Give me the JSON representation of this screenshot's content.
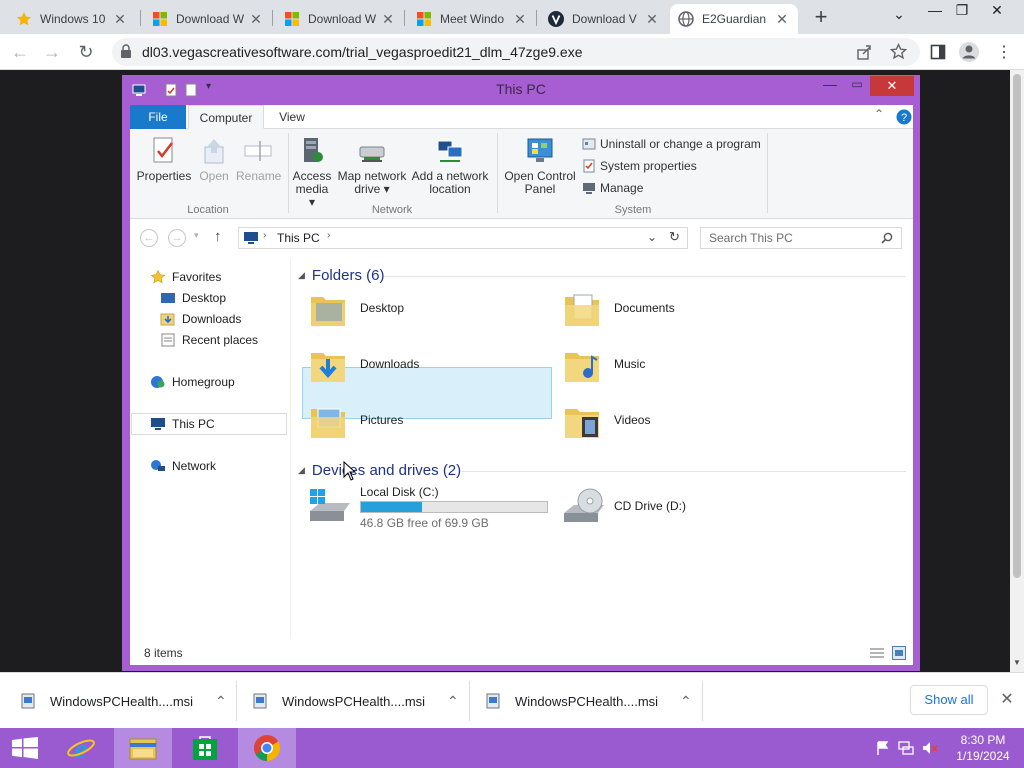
{
  "browser": {
    "tabs": [
      {
        "title": "Windows 10",
        "icon": "star-icon",
        "color": "#f4b400"
      },
      {
        "title": "Download W",
        "icon": "windows-logo-icon"
      },
      {
        "title": "Download W",
        "icon": "windows-logo-icon"
      },
      {
        "title": "Meet Windo",
        "icon": "windows-logo-icon"
      },
      {
        "title": "Download V",
        "icon": "v-logo-icon"
      },
      {
        "title": "E2Guardian",
        "icon": "globe-icon",
        "active": true
      }
    ],
    "new_tab": "+",
    "url": "dl03.vegascreativesoftware.com/trial_vegasproedit21_dlm_47zge9.exe"
  },
  "explorer": {
    "title": "This PC",
    "ribbon_tabs": [
      "File",
      "Computer",
      "View"
    ],
    "location_group": {
      "label": "Location",
      "buttons": [
        {
          "label": "Properties",
          "enabled": true
        },
        {
          "label": "Open",
          "enabled": false
        },
        {
          "label": "Rename",
          "enabled": false
        }
      ]
    },
    "network_group": {
      "label": "Network",
      "buttons": [
        {
          "label": "Access media",
          "line1": "Access",
          "line2": "media ▾"
        },
        {
          "label": "Map network drive",
          "line1": "Map network",
          "line2": "drive ▾"
        },
        {
          "label": "Add a network location",
          "line1": "Add a network",
          "line2": "location"
        }
      ]
    },
    "system_group": {
      "label": "System",
      "big": {
        "line1": "Open Control",
        "line2": "Panel"
      },
      "items": [
        "Uninstall or change a program",
        "System properties",
        "Manage"
      ]
    },
    "address_path": "This PC",
    "search_placeholder": "Search This PC",
    "nav": {
      "favorites": "Favorites",
      "favorite_items": [
        "Desktop",
        "Downloads",
        "Recent places"
      ],
      "homegroup": "Homegroup",
      "this_pc": "This PC",
      "network": "Network"
    },
    "folders_header": "Folders (6)",
    "folders": [
      "Desktop",
      "Documents",
      "Downloads",
      "Music",
      "Pictures",
      "Videos"
    ],
    "selected_folder": "Pictures",
    "devices_header": "Devices and drives (2)",
    "drives": [
      {
        "name": "Local Disk (C:)",
        "free": "46.8 GB free of 69.9 GB",
        "used_fraction": 0.33
      },
      {
        "name": "CD Drive (D:)"
      }
    ],
    "status": "8 items"
  },
  "downloads": {
    "items": [
      "WindowsPCHealth....msi",
      "WindowsPCHealth....msi",
      "WindowsPCHealth....msi"
    ],
    "show_all": "Show all"
  },
  "taskbar": {
    "time": "8:30 PM",
    "date": "1/19/2024"
  },
  "colors": {
    "accent": "#a65ed2",
    "taskbar": "#9a5bd0",
    "file_tab": "#1979ca",
    "drive_bar": "#26a0da"
  }
}
